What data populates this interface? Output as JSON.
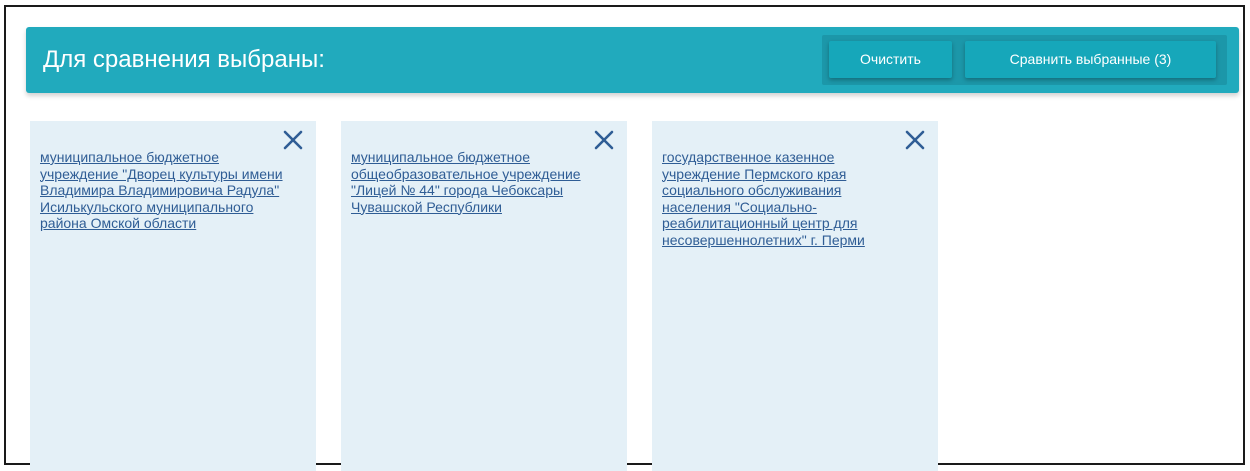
{
  "header": {
    "title": "Для сравнения выбраны:",
    "clear_label": "Очистить",
    "compare_label": "Сравнить выбранные (3)"
  },
  "cards": [
    {
      "name": "муниципальное бюджетное учреждение \"Дворец культуры имени Владимира Владимировича Радула\" Исилькульского муниципального района Омской области",
      "close_icon": "close-icon"
    },
    {
      "name": "муниципальное бюджетное общеобразовательное учреждение \"Лицей № 44\" города Чебоксары Чувашской Республики",
      "close_icon": "close-icon"
    },
    {
      "name": "государственное казенное учреждение Пермского края социального обслуживания населения \"Социально-реабилитационный центр для несовершеннолетних\" г. Перми",
      "close_icon": "close-icon"
    }
  ],
  "colors": {
    "header_bg": "#21aabd",
    "button_bg": "#16a7ba",
    "card_bg": "#e4f0f7",
    "link": "#2f5d95",
    "close_icon": "#2f5d95"
  }
}
